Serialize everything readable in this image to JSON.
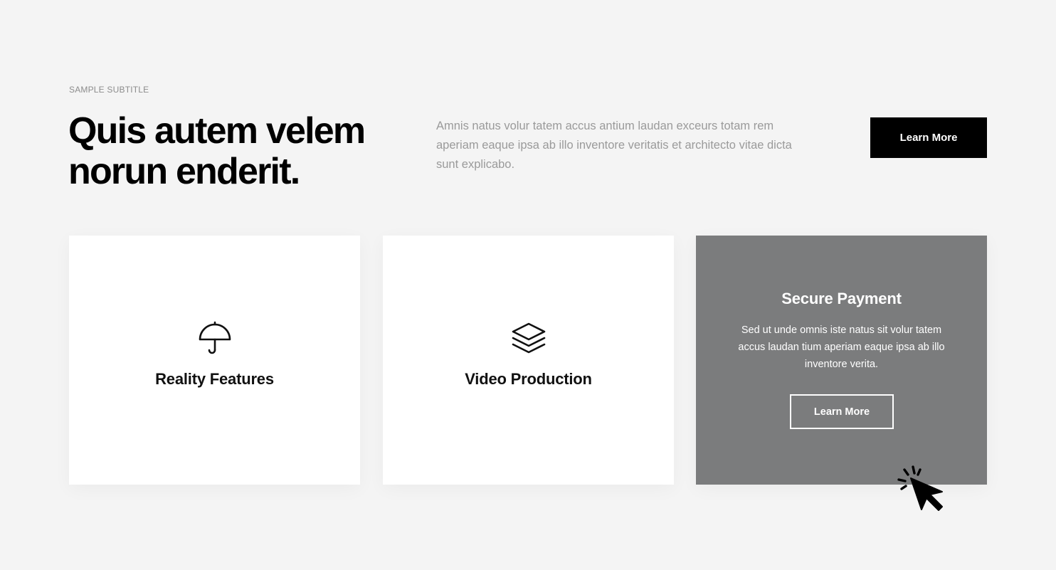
{
  "header": {
    "subtitle": "SAMPLE SUBTITLE",
    "title": "Quis autem velem norun enderit.",
    "description": "Amnis natus volur tatem accus antium laudan exceurs totam rem aperiam eaque ipsa ab illo inventore veritatis et architecto vitae dicta sunt explicabo.",
    "cta_label": "Learn More"
  },
  "cards": [
    {
      "title": "Reality Features",
      "icon": "umbrella-icon"
    },
    {
      "title": "Video Production",
      "icon": "layers-icon"
    },
    {
      "title": "Secure Payment",
      "text": "Sed ut unde omnis iste natus sit volur tatem accus laudan tium aperiam eaque ipsa ab illo inventore verita.",
      "button_label": "Learn More",
      "state": "hovered"
    }
  ],
  "colors": {
    "background": "#f4f4f4",
    "primary_button": "#000000",
    "card_hover": "#7b7c7d",
    "muted_text": "#9a9a9a"
  }
}
